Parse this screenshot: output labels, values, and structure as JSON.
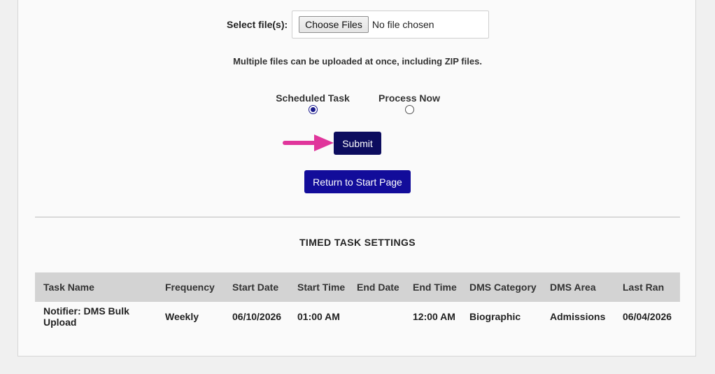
{
  "upload": {
    "label": "Select file(s):",
    "choose_button": "Choose Files",
    "no_file_text": "No file chosen",
    "hint": "Multiple files can be uploaded at once, including ZIP files."
  },
  "run_mode": {
    "options": [
      {
        "label": "Scheduled Task",
        "checked": true
      },
      {
        "label": "Process Now",
        "checked": false
      }
    ]
  },
  "buttons": {
    "submit": "Submit",
    "return": "Return to Start Page"
  },
  "colors": {
    "submit_bg": "#0c0c5e",
    "return_bg": "#120c9a",
    "arrow": "#e0359b"
  },
  "timed_settings": {
    "title": "TIMED TASK SETTINGS",
    "columns": [
      "Task Name",
      "Frequency",
      "Start Date",
      "Start Time",
      "End Date",
      "End Time",
      "DMS Category",
      "DMS Area",
      "Last Ran"
    ],
    "rows": [
      [
        "Notifier: DMS Bulk Upload",
        "Weekly",
        "06/10/2026",
        "01:00 AM",
        "",
        "12:00 AM",
        "Biographic",
        "Admissions",
        "06/04/2026"
      ]
    ]
  }
}
